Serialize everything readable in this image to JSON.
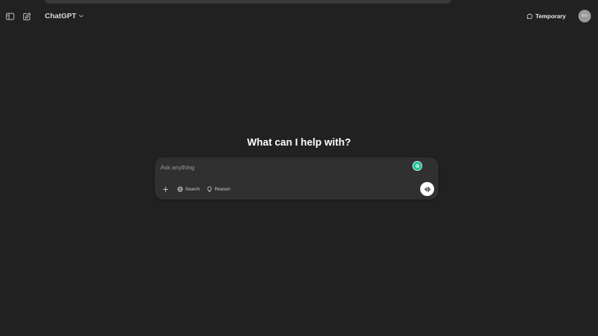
{
  "header": {
    "model_name": "ChatGPT",
    "temporary_label": "Temporary",
    "avatar_initials": "RO",
    "icons": {
      "sidebar_toggle": "sidebar-toggle-icon",
      "new_chat": "new-chat-icon",
      "model_dropdown": "chevron-down-icon",
      "temporary": "temporary-chat-icon"
    }
  },
  "main": {
    "heading": "What can I help with?"
  },
  "composer": {
    "placeholder": "Ask anything",
    "tools": {
      "search_label": "Search",
      "reason_label": "Reason"
    },
    "icons": {
      "attach": "plus-icon",
      "search": "globe-icon",
      "reason": "lightbulb-icon",
      "voice": "voice-waveform-icon",
      "extension": "grammarly-icon"
    }
  },
  "colors": {
    "background": "#212121",
    "composer": "#303030",
    "text": "#ececec",
    "muted_text": "#9b9b9b",
    "avatar": "#9a9a9a",
    "extension_badge": "#15c39a",
    "voice_button": "#ffffff"
  }
}
